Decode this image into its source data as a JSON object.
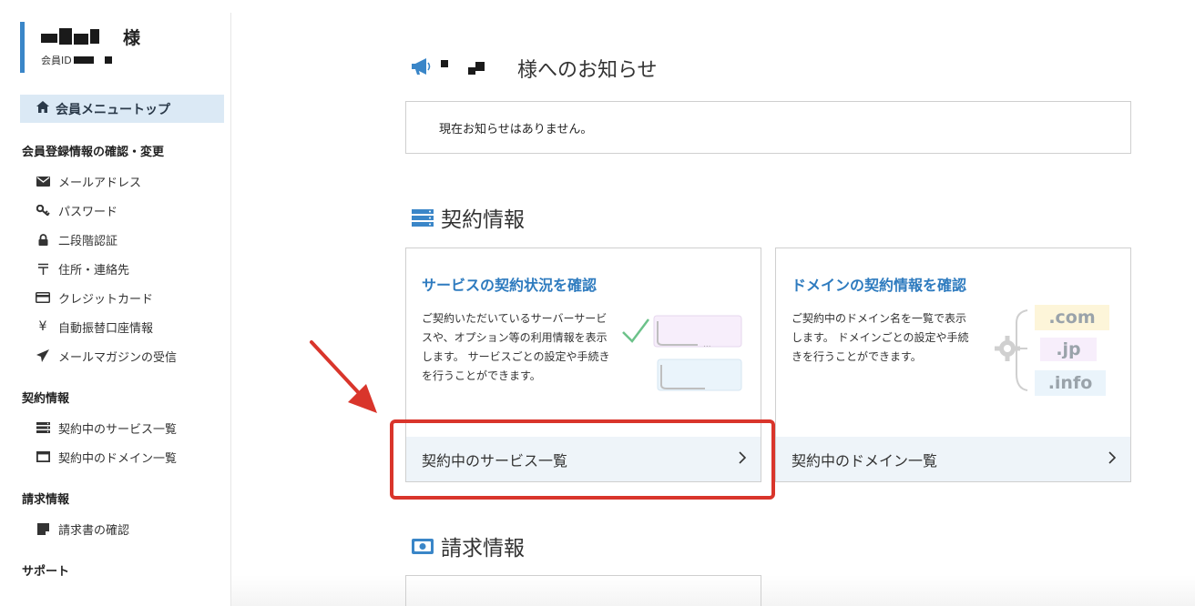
{
  "user": {
    "honorific": "様",
    "member_id_label": "会員ID"
  },
  "sidebar": {
    "top_item": "会員メニュートップ",
    "sections": [
      {
        "heading": "会員登録情報の確認・変更",
        "items": [
          {
            "label": "メールアドレス",
            "icon": "envelope-icon"
          },
          {
            "label": "パスワード",
            "icon": "key-icon"
          },
          {
            "label": "二段階認証",
            "icon": "lock-icon"
          },
          {
            "label": "住所・連絡先",
            "icon": "postal-mark-icon"
          },
          {
            "label": "クレジットカード",
            "icon": "credit-card-icon"
          },
          {
            "label": "自動振替口座情報",
            "icon": "yen-icon"
          },
          {
            "label": "メールマガジンの受信",
            "icon": "paper-plane-icon"
          }
        ]
      },
      {
        "heading": "契約情報",
        "items": [
          {
            "label": "契約中のサービス一覧",
            "icon": "server-icon"
          },
          {
            "label": "契約中のドメイン一覧",
            "icon": "window-icon"
          }
        ]
      },
      {
        "heading": "請求情報",
        "items": [
          {
            "label": "請求書の確認",
            "icon": "invoice-icon"
          }
        ]
      },
      {
        "heading": "サポート",
        "items": []
      }
    ]
  },
  "main": {
    "notice_title_suffix": "様へのお知らせ",
    "notice_text": "現在お知らせはありません。",
    "contract_title": "契約情報",
    "billing_title": "請求情報",
    "cards": [
      {
        "title": "サービスの契約状況を確認",
        "description": "ご契約いただいているサーバーサービスや、オプション等の利用情報を表示します。 サービスごとの設定や手続きを行うことができます。",
        "link_label": "契約中のサービス一覧"
      },
      {
        "title": "ドメインの契約情報を確認",
        "description": "ご契約中のドメイン名を一覧で表示します。 ドメインごとの設定や手続きを行うことができます。",
        "link_label": "契約中のドメイン一覧",
        "tlds": [
          ".com",
          ".jp",
          ".info"
        ]
      }
    ]
  },
  "colors": {
    "accent_blue": "#2e7bbf",
    "highlight_red": "#d9352b",
    "sidebar_active_bg": "#dbe9f5"
  }
}
